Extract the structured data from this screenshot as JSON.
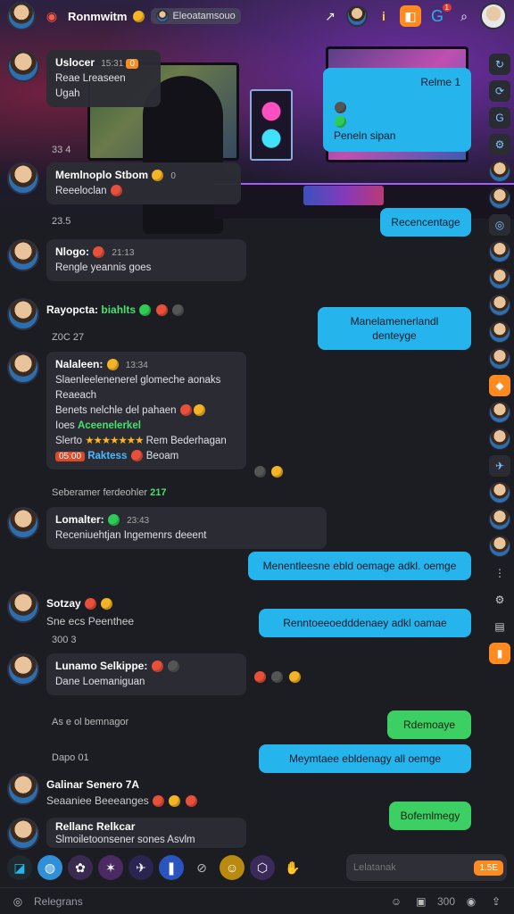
{
  "topbar": {
    "title": "Ronmwitm",
    "channel_chip": "Eleoatamsouo",
    "notification_count": "1",
    "icons": [
      "back-arrow-icon",
      "status-dot-icon",
      "app-logo-icon",
      "arrow-icon",
      "game-icon",
      "info-icon",
      "orange-badge-icon",
      "alert-icon",
      "search-icon",
      "profile-icon"
    ]
  },
  "messages": [
    {
      "name": "Uslocer",
      "time": "15:31",
      "text": "Reae Lreaseen Ugah",
      "badge": "0"
    },
    {
      "name": "Memlnoplo Stbom",
      "time": "0",
      "text": "Reeeloclan"
    },
    {
      "name": "Nlogo:",
      "time": "21:13",
      "text": "Rengle yeannis goes"
    },
    {
      "name": "Rayopcta:",
      "tag": "biahlts",
      "text": ""
    },
    {
      "name": "Nalaleen:",
      "time": "13:34",
      "text": "Slaenleelenenerel glomeche aonaks",
      "line2": "Reaeach",
      "line3": "Benets nelchle del pahaen",
      "line4_label": "Ioes",
      "line4_tag": "Aceenelerkel",
      "line5_label": "Slerto",
      "line5_text": "Rem Bederhagan",
      "line6_badge": "05:00",
      "line6_blue": "Raktess",
      "line6_tail": "Beoam"
    },
    {
      "name": "Lomalter:",
      "time": "23:43",
      "text": "Receniuehtjan Ingemenrs deeent"
    },
    {
      "name": "Sotzay",
      "text": "Sne ecs Peenthee"
    },
    {
      "name": "Lunamo Selkippe:",
      "text": "Dane Loemaniguan"
    },
    {
      "name": "Galinar Senero 7A",
      "text": "Seaaniee Beeeanges"
    },
    {
      "name": "Rellanc Relkcar",
      "text": "Slmoiletoonsener sones Asvlm"
    }
  ],
  "meta": {
    "m1": "33 4",
    "m2": "23.5",
    "m3": "Z0C 27",
    "m4_label": "Seberamer ferdeohler",
    "m4_value": "217",
    "m5": "300 3",
    "m6": "As e ol bemnagor",
    "m7": "Dapo 01"
  },
  "outgoing": [
    {
      "text": "Relme 1",
      "line2": "Peneln sipan"
    },
    {
      "text": "Recencentage"
    },
    {
      "text": "Manelamenerlandl denteyge"
    },
    {
      "text": "Menentleesne ebld oemage adkl. oemge"
    },
    {
      "text": "Renntoeeoedddenaey adkl oamae"
    },
    {
      "text": "Rdemoaye"
    },
    {
      "text": "Meymtaee ebldenagy all oemge"
    },
    {
      "text": "Bofemlmegy"
    }
  ],
  "compose": {
    "placeholder": "Lelatanak",
    "send_label": "1.5E"
  },
  "statusbar": {
    "label": "Relegrans",
    "count": "300"
  },
  "colors": {
    "accent_blue": "#25b5ec",
    "accent_green": "#3ccf63",
    "accent_orange": "#ff8a1f",
    "bg": "#1c1d22"
  }
}
